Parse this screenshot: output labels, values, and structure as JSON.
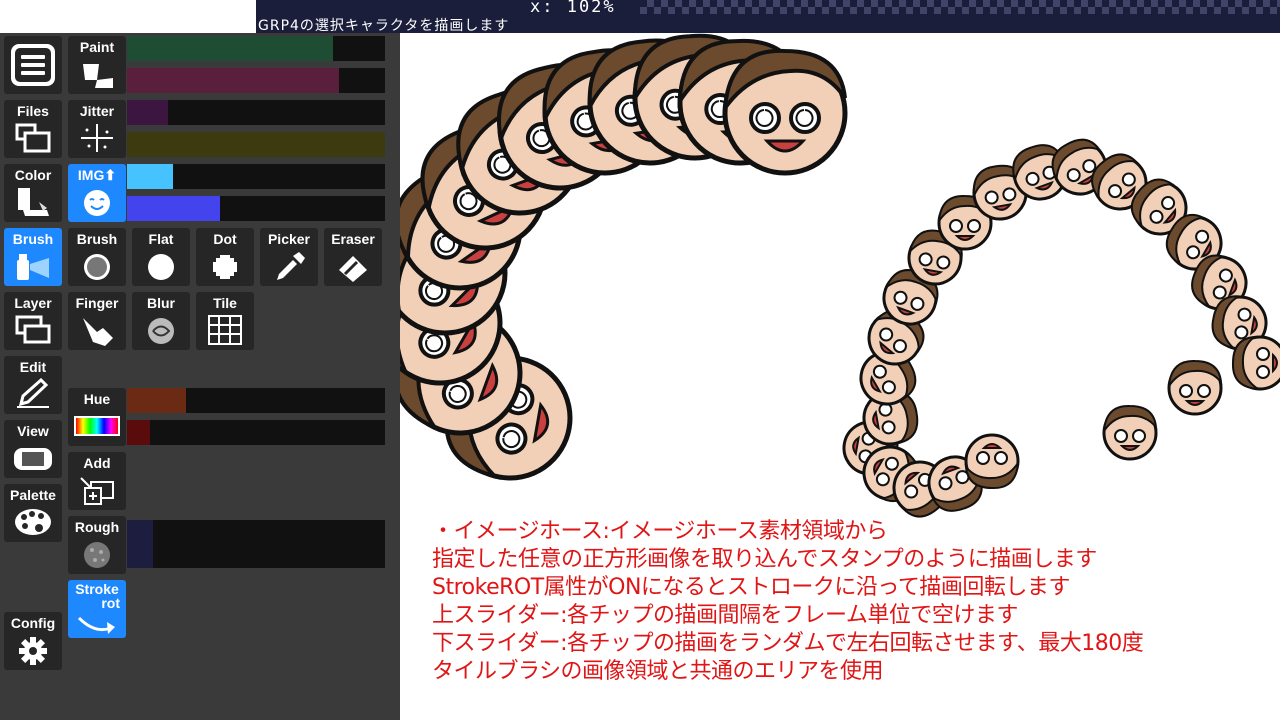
{
  "header": {
    "zoom": "x:  102%",
    "subtitle": "GRP4の選択キャラクタを描画します"
  },
  "left_column": [
    {
      "id": "menu",
      "label": "",
      "icon": "hamburger-menu-icon"
    },
    {
      "id": "files",
      "label": "Files",
      "icon": "files-icon"
    },
    {
      "id": "color",
      "label": "Color",
      "icon": "color-paint-icon"
    },
    {
      "id": "brush",
      "label": "Brush",
      "icon": "brush-spray-icon",
      "active": true
    },
    {
      "id": "layer",
      "label": "Layer",
      "icon": "layer-icon"
    },
    {
      "id": "edit",
      "label": "Edit",
      "icon": "edit-pen-icon"
    },
    {
      "id": "view",
      "label": "View",
      "icon": "view-console-icon"
    },
    {
      "id": "palette",
      "label": "Palette",
      "icon": "palette-icon"
    },
    {
      "id": "config",
      "label": "Config",
      "icon": "gear-icon"
    }
  ],
  "tools": {
    "paint": "Paint",
    "jitter": "Jitter",
    "img": "IMG",
    "brush": "Brush",
    "flat": "Flat",
    "dot": "Dot",
    "picker": "Picker",
    "eraser": "Eraser",
    "finger": "Finger",
    "blur": "Blur",
    "tile": "Tile",
    "hue": "Hue",
    "add": "Add",
    "rough": "Rough",
    "stroke_rot_line1": "Stroke",
    "stroke_rot_line2": "rot"
  },
  "sliders": {
    "paint_1": {
      "value": 0.8,
      "color": "#1f4d34"
    },
    "paint_2": {
      "value": 0.82,
      "color": "#5a1f3c"
    },
    "jitter_1": {
      "value": 0.16,
      "color": "#3c1640"
    },
    "jitter_2": {
      "value": 1.0,
      "color": "#3d3a10"
    },
    "img_1": {
      "value": 0.18,
      "color": "#46c2ff"
    },
    "img_2": {
      "value": 0.36,
      "color": "#4444ee"
    },
    "hue_1": {
      "value": 0.23,
      "color": "#6b2a14"
    },
    "hue_2": {
      "value": 0.09,
      "color": "#5a0c0c"
    },
    "rough_1": {
      "value": 0.1,
      "color": "#1d1d40"
    }
  },
  "canvas_text": [
    "・イメージホース:イメージホース素材領域から",
    "指定した任意の正方形画像を取り込んでスタンプのように描画します",
    "StrokeROT属性がONになるとストロークに沿って描画回転します",
    "上スライダー:各チップの描画間隔をフレーム単位で空けます",
    "下スライダー:各チップの描画をランダムで左右回転させます、最大180度",
    "タイルブラシの画像領域と共通のエリアを使用"
  ],
  "colors": {
    "active_accent": "#1e88ff",
    "description_text": "#e01515"
  }
}
